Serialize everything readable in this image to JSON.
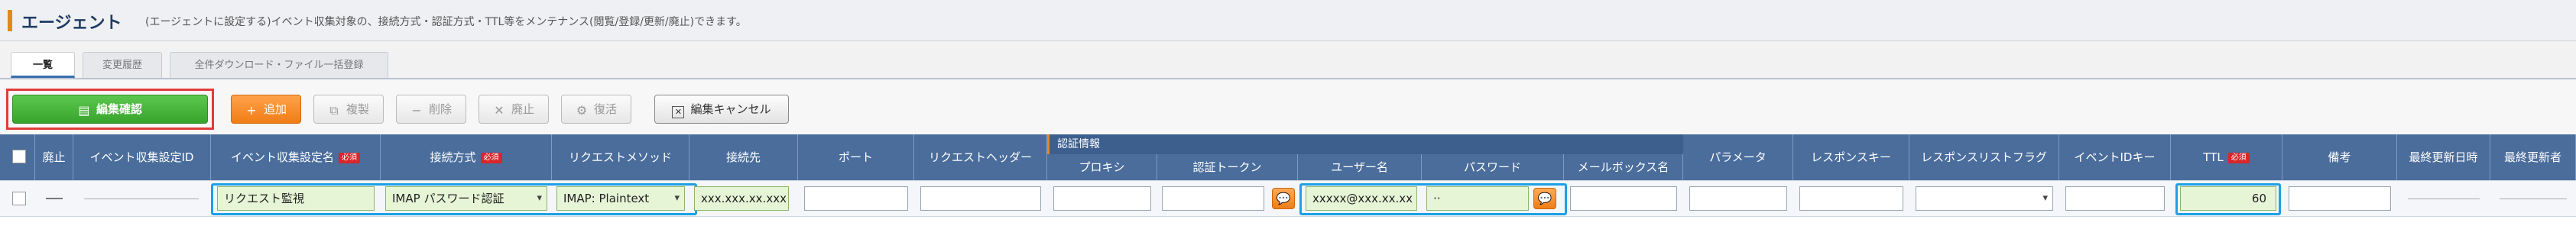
{
  "header": {
    "title": "エージェント",
    "description": "(エージェントに設定する)イベント収集対象の、接続方式・認証方式・TTL等をメンテナンス(閲覧/登録/更新/廃止)できます。"
  },
  "tabs": [
    {
      "label": "一覧"
    },
    {
      "label": "変更履歴"
    },
    {
      "label": "全件ダウンロード・ファイル一括登録"
    }
  ],
  "toolbar": {
    "confirm_label": "編集確認",
    "add_label": "追加",
    "copy_label": "複製",
    "delete_label": "削除",
    "discard_label": "廃止",
    "restore_label": "復活",
    "cancel_label": "編集キャンセル"
  },
  "grid": {
    "required_badge": "必須",
    "group_header": "認証情報",
    "columns": {
      "discard": "廃止",
      "id": "イベント収集設定ID",
      "name": "イベント収集設定名",
      "connection": "接続方式",
      "method": "リクエストメソッド",
      "destination": "接続先",
      "port": "ポート",
      "request_header": "リクエストヘッダー",
      "proxy": "プロキシ",
      "token": "認証トークン",
      "username": "ユーザー名",
      "password": "パスワード",
      "mailbox": "メールボックス名",
      "parameter": "パラメータ",
      "response_key": "レスポンスキー",
      "response_list_flag": "レスポンスリストフラグ",
      "event_id_key": "イベントIDキー",
      "ttl": "TTL",
      "remarks": "備考",
      "last_update_date": "最終更新日時",
      "last_updater": "最終更新者"
    },
    "row": {
      "discard": "—",
      "name": "リクエスト監視",
      "connection": "IMAP パスワード認証",
      "method": "IMAP: Plaintext",
      "destination": "xxx.xxx.xx.xxx",
      "port": "",
      "request_header": "",
      "proxy": "",
      "token": "",
      "username": "xxxxx@xxx.xx.xx",
      "password": "··",
      "mailbox": "",
      "parameter": "",
      "response_key": "",
      "response_list_flag": "",
      "event_id_key": "",
      "ttl": "60",
      "remarks": ""
    }
  },
  "colors": {
    "header_bg": "#4a6d9c",
    "confirm_green": "#37a42c",
    "add_orange": "#f07d16",
    "required_red": "#d9262a",
    "highlight_blue": "#1ea0e6",
    "highlight_red": "#e23b3b"
  }
}
